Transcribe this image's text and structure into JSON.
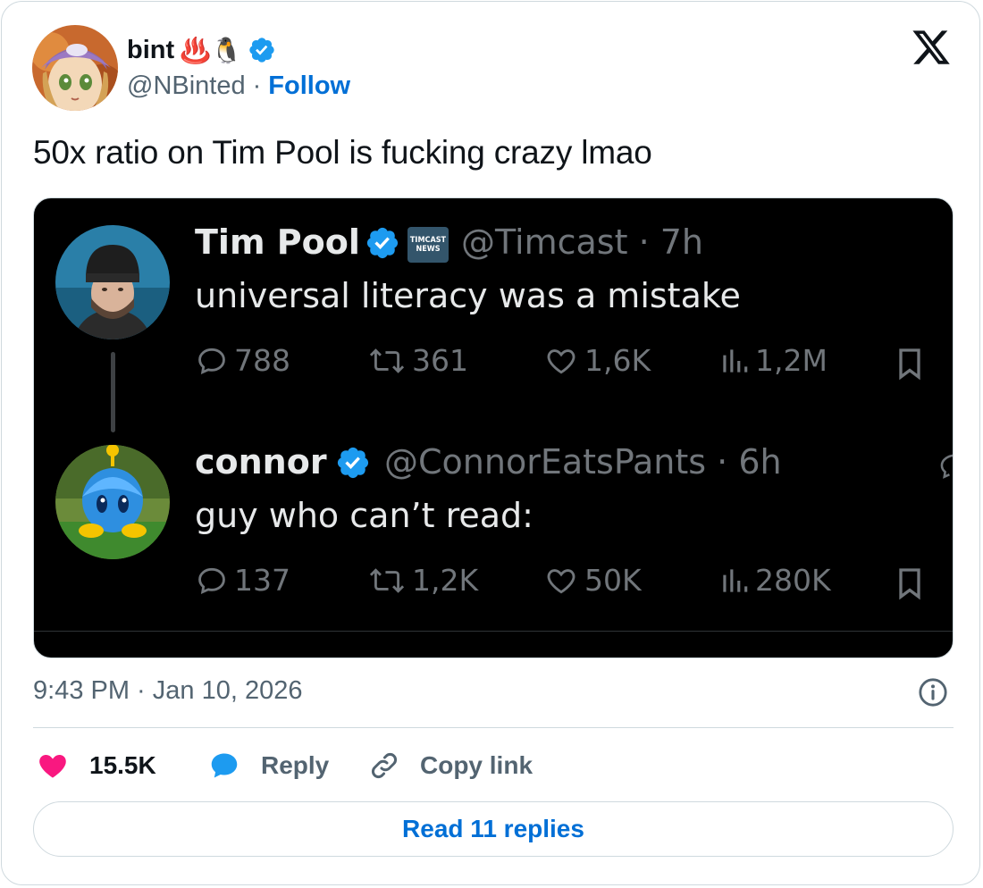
{
  "author": {
    "display_name": "bint",
    "emoji": "♨️🐧",
    "handle": "@NBinted",
    "separator": "·",
    "follow_label": "Follow"
  },
  "tweet": {
    "text": "50x ratio on Tim Pool is fucking crazy lmao",
    "timestamp": "9:43 PM · Jan 10, 2026"
  },
  "embedded_screenshot": {
    "post1": {
      "name": "Tim Pool",
      "badge_text": [
        "TIMCAST",
        "NEWS"
      ],
      "handle_time": "@Timcast · 7h",
      "text": "universal literacy was a mistake",
      "replies": "788",
      "reposts": "361",
      "likes": "1,6K",
      "views": "1,2M"
    },
    "post2": {
      "name": "connor",
      "handle_time": "@ConnorEatsPants · 6h",
      "text": "guy who can’t read:",
      "replies": "137",
      "reposts": "1,2K",
      "likes": "50K",
      "views": "280K"
    }
  },
  "actions": {
    "likes_count": "15.5K",
    "reply_label": "Reply",
    "copy_link_label": "Copy link"
  },
  "read_replies_label": "Read 11 replies",
  "colors": {
    "like": "#f91880",
    "reply": "#1d9bf0",
    "link": "#006fd6",
    "verified": "#1d9bf0"
  }
}
